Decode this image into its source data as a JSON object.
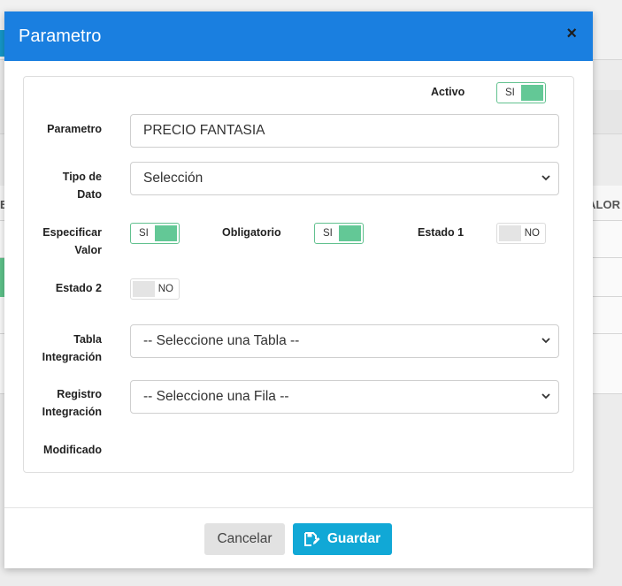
{
  "modal": {
    "title": "Parametro",
    "close_glyph": "×"
  },
  "form": {
    "activo": {
      "label": "Activo",
      "value": "SI",
      "on": true
    },
    "parametro": {
      "label": "Parametro",
      "value": "PRECIO FANTASIA"
    },
    "tipo_dato": {
      "label_line1": "Tipo de",
      "label_line2": "Dato",
      "value": "Selección"
    },
    "especificar_valor": {
      "label_line1": "Especificar",
      "label_line2": "Valor",
      "value": "SI",
      "on": true
    },
    "obligatorio": {
      "label": "Obligatorio",
      "value": "SI",
      "on": true
    },
    "estado1": {
      "label": "Estado 1",
      "value": "NO",
      "on": false
    },
    "estado2": {
      "label": "Estado 2",
      "value": "NO",
      "on": false
    },
    "tabla_integracion": {
      "label_line1": "Tabla",
      "label_line2": "Integración",
      "value": "-- Seleccione una Tabla --"
    },
    "registro_integracion": {
      "label_line1": "Registro",
      "label_line2": "Integración",
      "value": "-- Seleccione una Fila --"
    },
    "modificado": {
      "label": "Modificado"
    }
  },
  "footer": {
    "cancel_label": "Cancelar",
    "save_label": "Guardar"
  },
  "background": {
    "column_header_right": "ALOR",
    "column_header_left": "E"
  },
  "colors": {
    "header": "#1a7fe0",
    "toggle_on": "#63c896",
    "save_button": "#11a8d6"
  }
}
